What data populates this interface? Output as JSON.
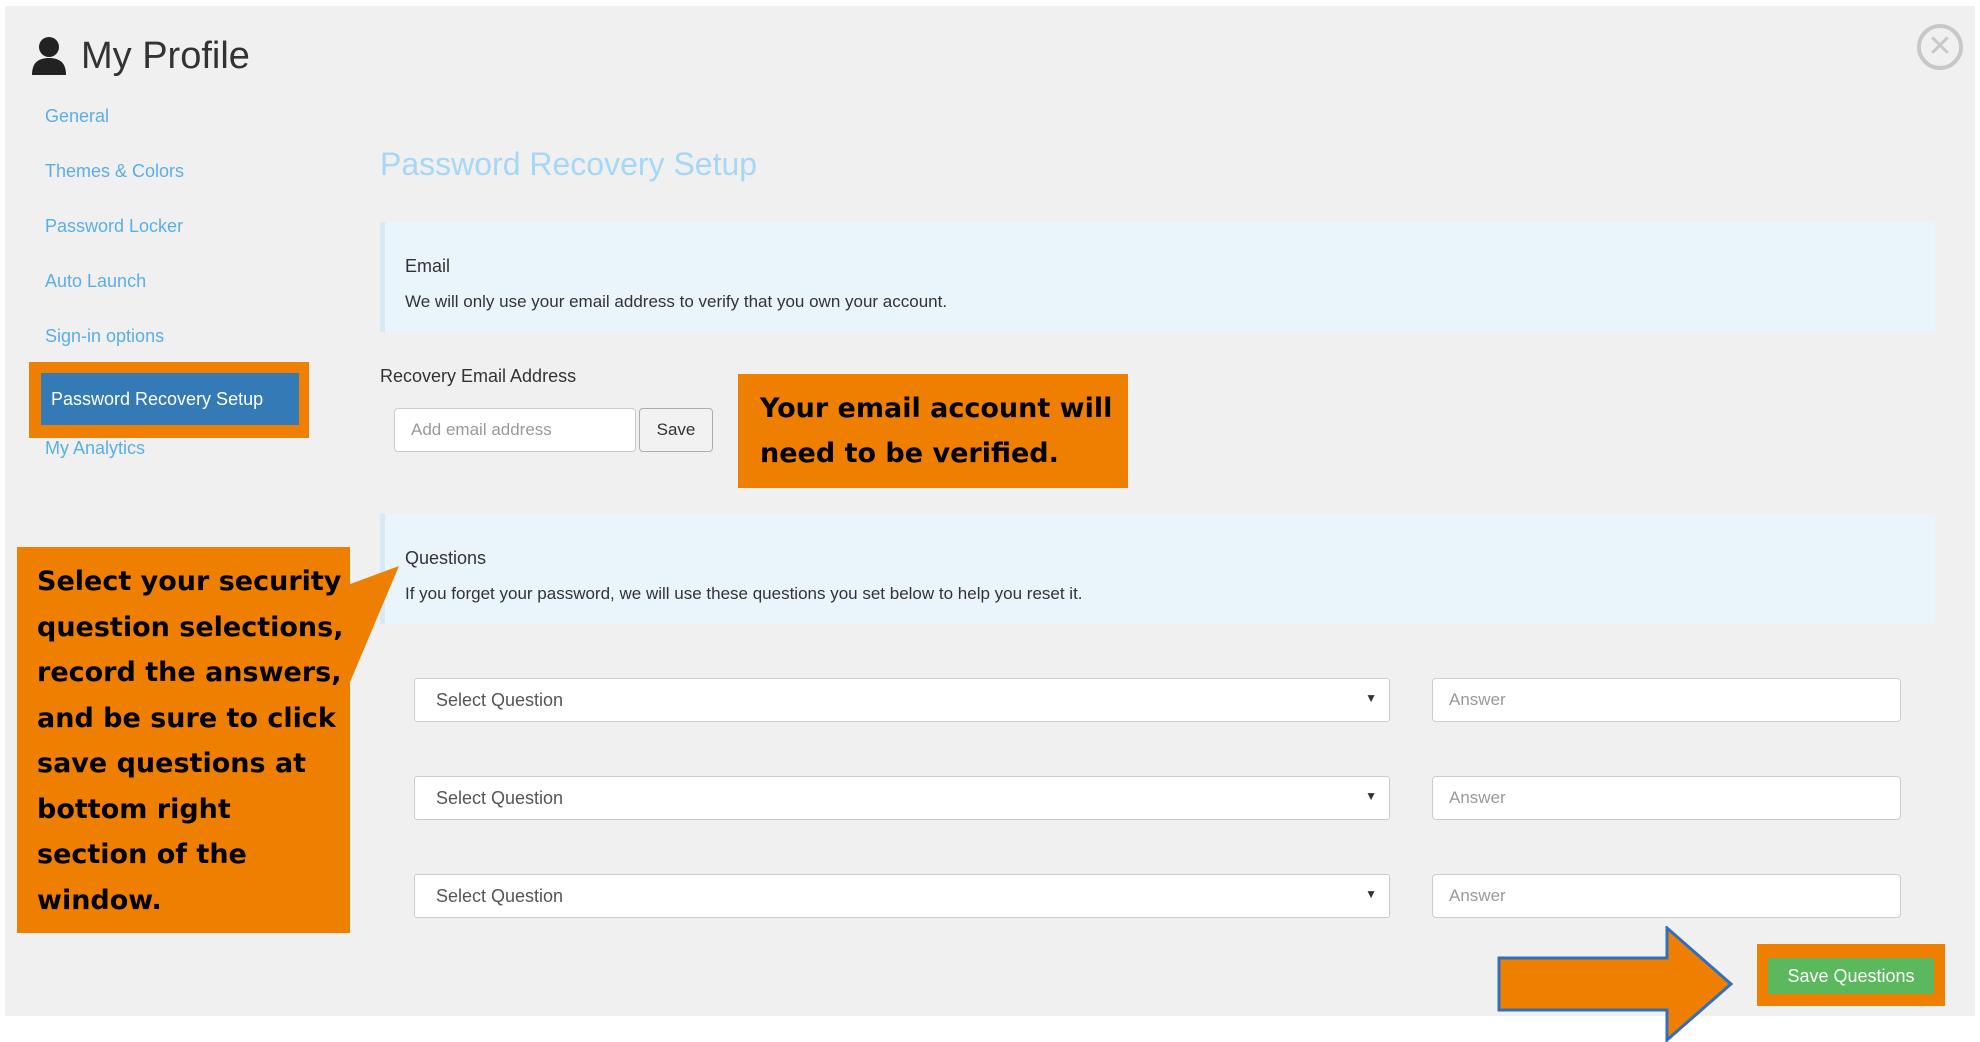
{
  "header": {
    "title": "My Profile",
    "user_icon": "user-icon",
    "close_icon": "close-icon"
  },
  "sidebar": {
    "items": [
      {
        "label": "General",
        "active": false
      },
      {
        "label": "Themes & Colors",
        "active": false
      },
      {
        "label": "Password Locker",
        "active": false
      },
      {
        "label": "Auto Launch",
        "active": false
      },
      {
        "label": "Sign-in options",
        "active": false
      },
      {
        "label": "Password Recovery Setup",
        "active": true
      },
      {
        "label": "My Analytics",
        "active": false
      }
    ]
  },
  "main": {
    "title": "Password Recovery Setup",
    "email_panel": {
      "heading": "Email",
      "description": "We will only use your email address to verify that you own your account."
    },
    "recovery_email": {
      "label": "Recovery Email Address",
      "value": "",
      "placeholder": "Add email address",
      "save_label": "Save"
    },
    "questions_panel": {
      "heading": "Questions",
      "description": "If you forget your password, we will use these questions you set below to help you reset it."
    },
    "questions": [
      {
        "selected": "Select Question",
        "answer_placeholder": "Answer"
      },
      {
        "selected": "Select Question",
        "answer_placeholder": "Answer"
      },
      {
        "selected": "Select Question",
        "answer_placeholder": "Answer"
      }
    ],
    "save_questions_label": "Save Questions"
  },
  "callouts": {
    "email": [
      "Your email account will",
      "need to be verified."
    ],
    "questions": [
      "Select your security",
      "question selections,",
      "record the answers,",
      "and be sure to click",
      "save questions at",
      "bottom right",
      "section of the",
      "window."
    ]
  },
  "colors": {
    "callout": "#ef7f00",
    "active_nav": "#337ab7",
    "link": "#5aaee6",
    "save_button": "#5cb85c"
  }
}
